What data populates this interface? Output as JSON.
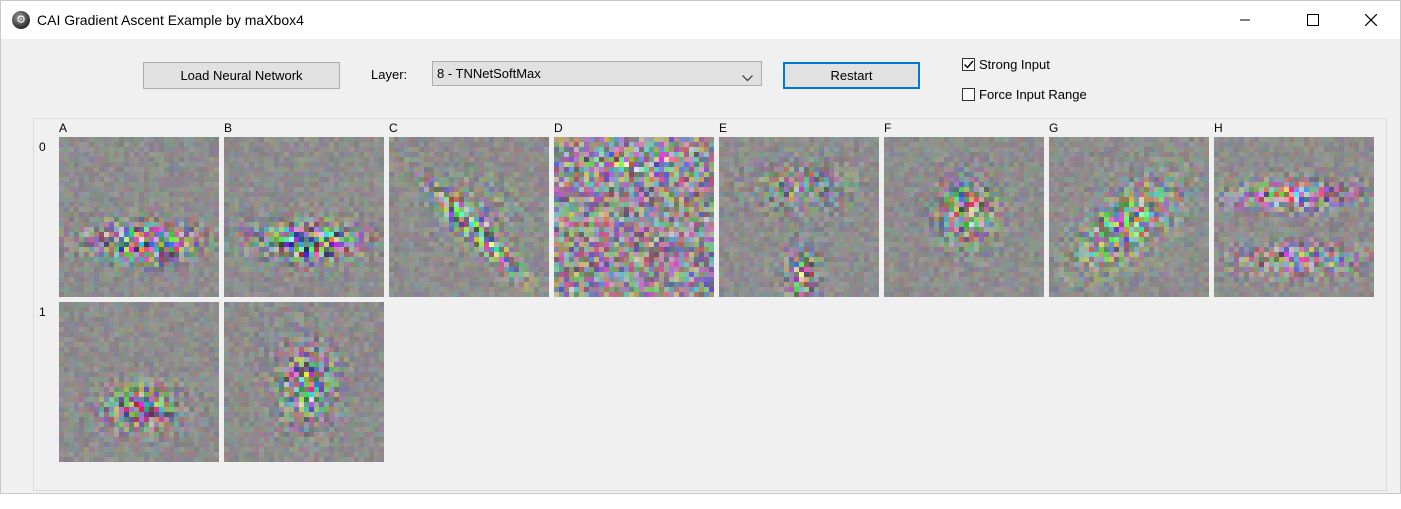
{
  "window": {
    "title": "CAI Gradient Ascent Example by maXbox4",
    "icon": "app-gear-icon",
    "controls": [
      "minimize-icon",
      "maximize-icon",
      "close-icon"
    ]
  },
  "toolbar": {
    "load_label": "Load Neural Network",
    "layer_label": "Layer:",
    "layer_value": "8 - TNNetSoftMax",
    "restart_label": "Restart",
    "strong_input_label": "Strong Input",
    "strong_input_checked": true,
    "force_range_label": "Force Input Range",
    "force_range_checked": false
  },
  "grid": {
    "columns": [
      "A",
      "B",
      "C",
      "D",
      "E",
      "F",
      "G",
      "H"
    ],
    "rows": [
      "0",
      "1"
    ],
    "tiles": [
      {
        "row": 0,
        "col": 0,
        "pattern": "band-low"
      },
      {
        "row": 0,
        "col": 1,
        "pattern": "band-low"
      },
      {
        "row": 0,
        "col": 2,
        "pattern": "diagonal"
      },
      {
        "row": 0,
        "col": 3,
        "pattern": "scatter"
      },
      {
        "row": 0,
        "col": 4,
        "pattern": "vertical-bars"
      },
      {
        "row": 0,
        "col": 5,
        "pattern": "center"
      },
      {
        "row": 0,
        "col": 6,
        "pattern": "diagonal-green"
      },
      {
        "row": 0,
        "col": 7,
        "pattern": "top-band"
      },
      {
        "row": 1,
        "col": 0,
        "pattern": "center-low"
      },
      {
        "row": 1,
        "col": 1,
        "pattern": "vertical-center"
      }
    ]
  },
  "colors": {
    "window_bg": "#f0f0f0",
    "tile_gray": "#8d8d8d",
    "focus_blue": "#0078d7"
  }
}
